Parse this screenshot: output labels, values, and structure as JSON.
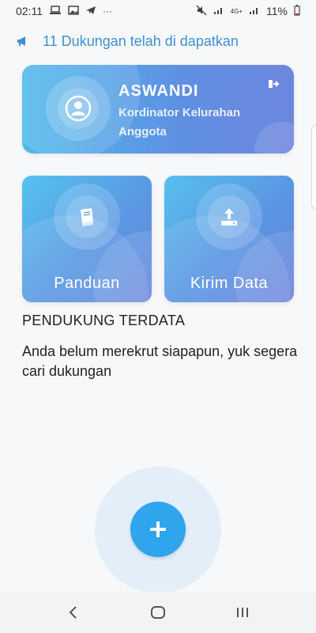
{
  "status_bar": {
    "time": "02:11",
    "battery": "11%",
    "network": "4G+",
    "more": "···"
  },
  "announcement": {
    "text": "11 Dukungan telah di dapatkan"
  },
  "profile": {
    "name": "ASWANDI",
    "role": "Kordinator Kelurahan",
    "level": "Anggota"
  },
  "tiles": [
    {
      "label": "Panduan",
      "icon": "book-icon"
    },
    {
      "label": "Kirim Data",
      "icon": "upload-icon"
    }
  ],
  "supporters": {
    "title": "PENDUKUNG TERDATA",
    "empty_message": "Anda belum merekrut siapapun, yuk segera cari dukungan"
  },
  "colors": {
    "accent": "#3f8fd6",
    "fab": "#2fa5ee",
    "card_gradient_start": "#4fb9ec",
    "card_gradient_end": "#6d86de"
  }
}
